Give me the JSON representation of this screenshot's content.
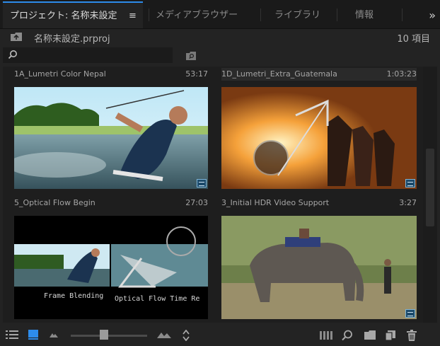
{
  "tabs": {
    "project": "プロジェクト: 名称未設定",
    "media_browser": "メディアブラウザー",
    "library": "ライブラリ",
    "info": "情報",
    "menu_glyph": "≡",
    "overflow_glyph": "»"
  },
  "path": {
    "project_file": "名称未設定.prproj",
    "item_count": "10 項目"
  },
  "search": {
    "placeholder": ""
  },
  "clips": [
    {
      "name": "1A_Lumetri Color Nepal",
      "duration": "53:17"
    },
    {
      "name": "1D_Lumetri_Extra_Guatemala",
      "duration": "1:03:23"
    },
    {
      "name": "5_Optical Flow Begin",
      "duration": "27:03"
    },
    {
      "name": "3_Initial HDR Video Support",
      "duration": "3:27"
    }
  ],
  "thumb_text": {
    "frame_blending": "Frame Blending",
    "optical_flow": "Optical Flow Time Re"
  },
  "zoom_level": 0.43,
  "icons": {
    "up": "folder-up-icon",
    "search": "search-icon",
    "new_bin_search": "bin-search-icon",
    "list_view": "list-view-icon",
    "icon_view": "icon-view-icon",
    "freeform": "freeform-view-icon",
    "zoom_small": "zoom-small-icon",
    "zoom_large": "zoom-large-icon",
    "sort": "sort-icon",
    "automate": "automate-sequence-icon",
    "find": "find-icon",
    "new_bin": "new-bin-icon",
    "new_item": "new-item-icon",
    "clear": "trash-icon"
  }
}
